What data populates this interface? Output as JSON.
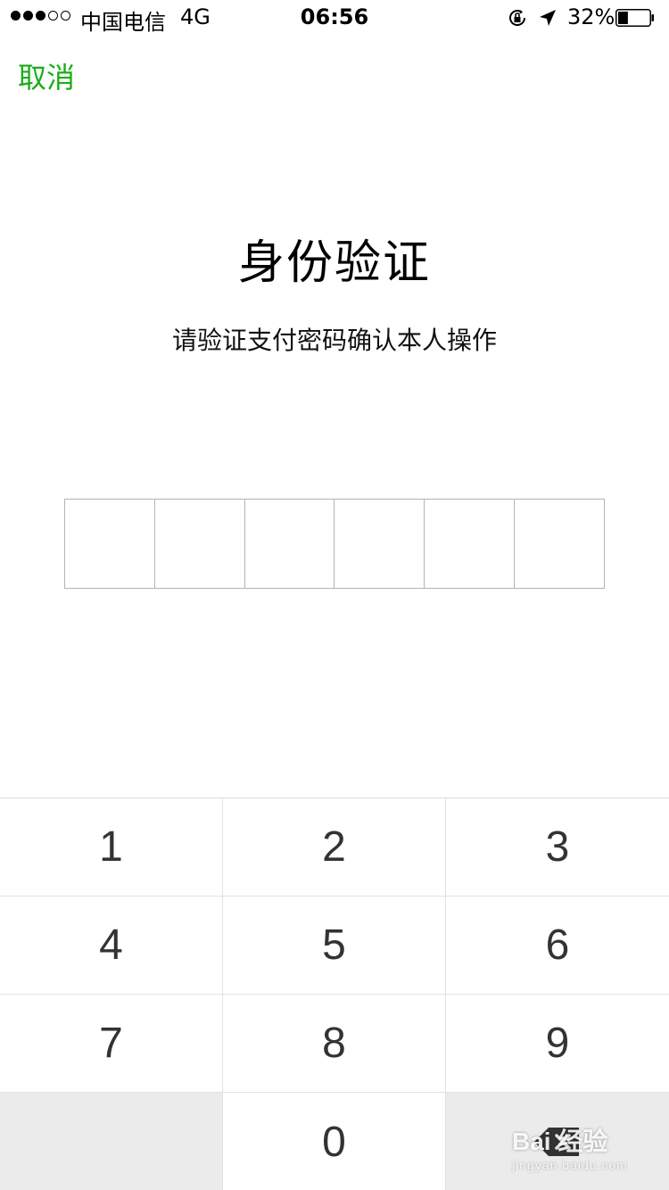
{
  "status_bar": {
    "signal_dots": [
      true,
      true,
      true,
      false,
      false
    ],
    "carrier": "中国电信",
    "network": "4G",
    "time": "06:56",
    "battery_percent": "32%",
    "battery_level": 0.32
  },
  "nav": {
    "cancel_label": "取消"
  },
  "auth": {
    "title": "身份验证",
    "subtitle": "请验证支付密码确认本人操作"
  },
  "password": {
    "length": 6
  },
  "keypad": {
    "keys": [
      "1",
      "2",
      "3",
      "4",
      "5",
      "6",
      "7",
      "8",
      "9",
      "",
      "0",
      "delete"
    ]
  },
  "watermark": {
    "main": "Bai 经验",
    "sub": "jingyan.baidu.com"
  },
  "colors": {
    "accent": "#1aad19",
    "key_text": "#333333",
    "key_gray": "#ebebeb"
  }
}
